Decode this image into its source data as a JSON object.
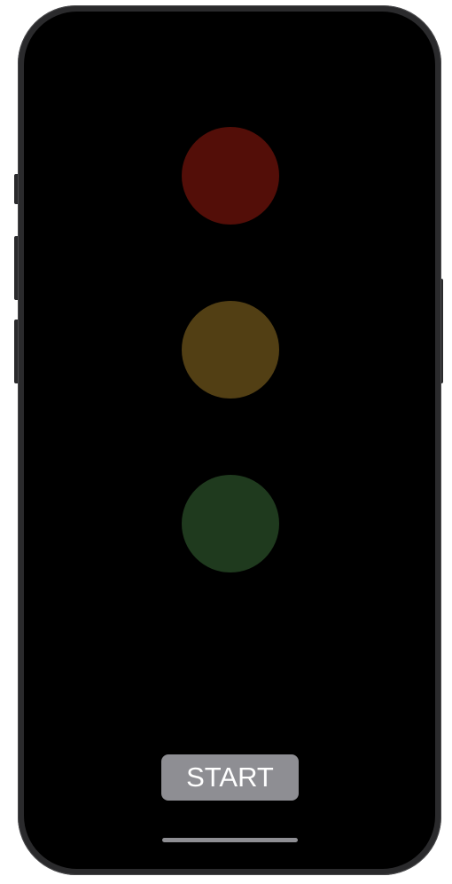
{
  "traffic_light": {
    "lights": [
      {
        "name": "red",
        "color": "#530e08",
        "state": "off"
      },
      {
        "name": "yellow",
        "color": "#523f14",
        "state": "off"
      },
      {
        "name": "green",
        "color": "#1f3a1e",
        "state": "off"
      }
    ]
  },
  "controls": {
    "start_label": "START",
    "start_button_color": "#8e8e93"
  },
  "device": {
    "screen_color": "#000000",
    "frame_color": "#2a2a2c"
  }
}
